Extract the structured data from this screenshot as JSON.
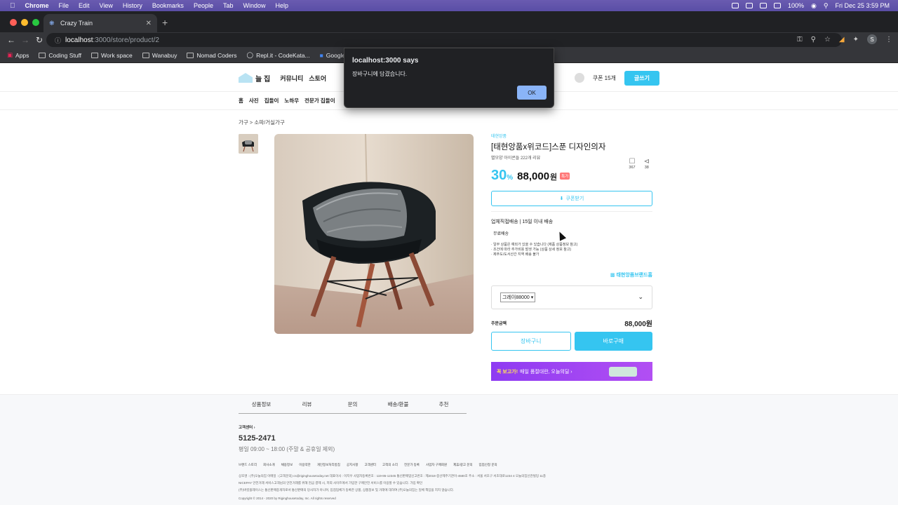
{
  "menubar": {
    "app": "Chrome",
    "items": [
      "File",
      "Edit",
      "View",
      "History",
      "Bookmarks",
      "People",
      "Tab",
      "Window",
      "Help"
    ],
    "battery": "100%",
    "datetime": "Fri Dec 25  3:59 PM"
  },
  "browser": {
    "tab_title": "Crazy Train",
    "url_host": "localhost",
    "url_path": ":3000/store/product/2",
    "profile_initial": "S",
    "bookmarks": [
      "Apps",
      "Coding Stuff",
      "Work space",
      "Wanabuy",
      "Nomad Coders",
      "Repl.it - CodeKata...",
      "Google"
    ]
  },
  "site": {
    "logo": "늘 집",
    "nav": [
      "커뮤니티",
      "스토어"
    ],
    "coupon": "쿠폰 15개",
    "write": "글쓰기",
    "subnav": [
      "홈",
      "사진",
      "집들이",
      "노하우",
      "전문가 집들이"
    ]
  },
  "product": {
    "breadcrumb": "가구 > 소파/거실가구",
    "brand": "태현앙품",
    "title": "[태현앙품x위코드]스푼 디자인의자",
    "rating": "별모양 아이콘들   222개 리뷰",
    "discount": "30",
    "discount_pct": "%",
    "price": "88,000",
    "won": "원",
    "special_badge": "특가",
    "bookmark_count": "367",
    "share_count": "38",
    "coupon_btn": "쿠폰받기",
    "shipping_title": "업체직접배송 | 15일 이내 배송",
    "shipping_free": "무료배송",
    "shipping_notes": [
      "· 일부 상품은 예외가 있을 수 있습니다 (제품 상품정보 참고)",
      "· 조건에 따라 추가비용 발생 가능 (상품 상세 정보 참고)",
      "· 제주도/도서산간 지역 배송 불가"
    ],
    "brand_shop": "태현앙품브랜드홈",
    "option_selected": "그레이88000",
    "total_label": "주문금액",
    "total_value": "88,000원",
    "cart_btn": "장바구니",
    "buy_btn": "바로구매",
    "promo_highlight": "꼭 보고가!",
    "promo_text": "매일 품절대란, 오늘의딜 ›"
  },
  "tabs": [
    "상품정보",
    "리뷰",
    "문의",
    "배송/환불",
    "추천"
  ],
  "footer": {
    "cs_label": "고객센터 ›",
    "phone": "5125-2471",
    "hours": "평일 09:00 ~ 18:00 (주말 & 공휴일 제외)",
    "links": [
      "브랜드 스토리",
      "회사소개",
      "채용정보",
      "이용약관",
      "개인정보처리방침",
      "공지사항",
      "고객센터",
      "고객의 소리",
      "전문가 등록",
      "사업자 구매회원",
      "제휴/광고 문의",
      "입점신청 문의"
    ],
    "line1": "상호명 : (주)오늘의집  이메일 : (고객문의) cs@riginghousetoday.net  대표이사 : 이지우  사업자등록번호 : 119-86-12345  통신판매업신고번호 : 제2018-중산제주기관이-4580호  주소 : 서울 서초구 서초대로1234 4 오늘의집신관빌딩 11층",
    "line2": "NICEPAY 안전거래 서비스고객님의 안전거래를 위해 현금 결제 시, 저희 사이트에서 가입한 구매안전 서비스를 이용할 수 있습니다. 가입 확인",
    "line3": "(주)버킷플레이스는 통신판매중개자로서 통신판매의 당사자가 아니며, 입점업체가 등록한 상품, 상품정보 및 거래에 대하여 (주)오늘의집는 일체 책임을 지지 않습니다.",
    "copyright": "Copyright © 2014 - 2020 by Riginghousetoday, Inc. All rights reserved"
  },
  "alert": {
    "title": "localhost:3000 says",
    "message": "장바구니에 담겼습니다.",
    "ok": "OK"
  }
}
